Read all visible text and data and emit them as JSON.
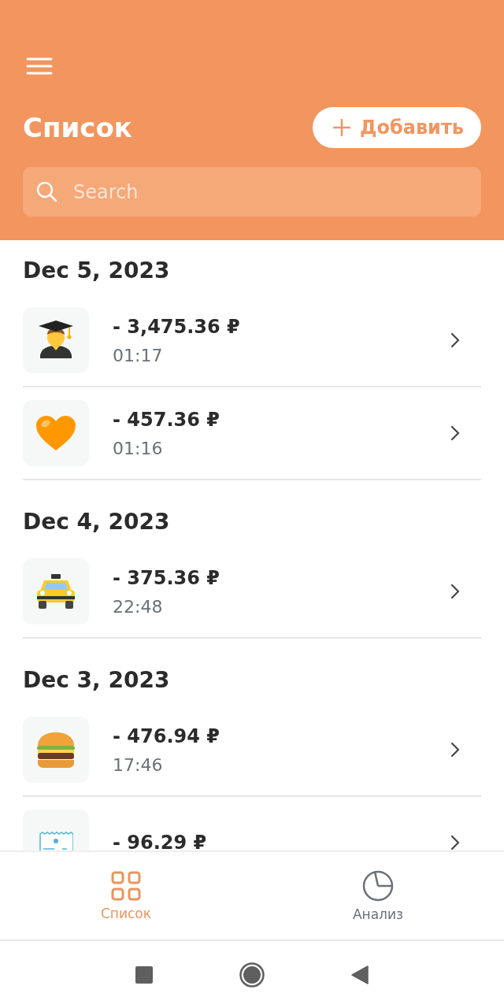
{
  "header": {
    "title": "Список",
    "add_button": "Добавить",
    "search": {
      "placeholder": "Search"
    }
  },
  "sections": [
    {
      "date": "Dec 5, 2023",
      "items": [
        {
          "kind": "graduate",
          "amount": "- 3,475.36 ₽",
          "time": "01:17"
        },
        {
          "kind": "heart",
          "amount": "- 457.36 ₽",
          "time": "01:16"
        }
      ]
    },
    {
      "date": "Dec 4, 2023",
      "items": [
        {
          "kind": "taxi",
          "amount": "- 375.36 ₽",
          "time": "22:48"
        }
      ]
    },
    {
      "date": "Dec 3, 2023",
      "items": [
        {
          "kind": "burger",
          "amount": "- 476.94 ₽",
          "time": "17:46"
        },
        {
          "kind": "receipt",
          "amount": "- 96.29 ₽"
        }
      ]
    }
  ],
  "tabs": [
    {
      "kind": "grid",
      "label": "Список",
      "selected": true
    },
    {
      "kind": "pie",
      "label": "Анализ",
      "selected": false
    }
  ]
}
